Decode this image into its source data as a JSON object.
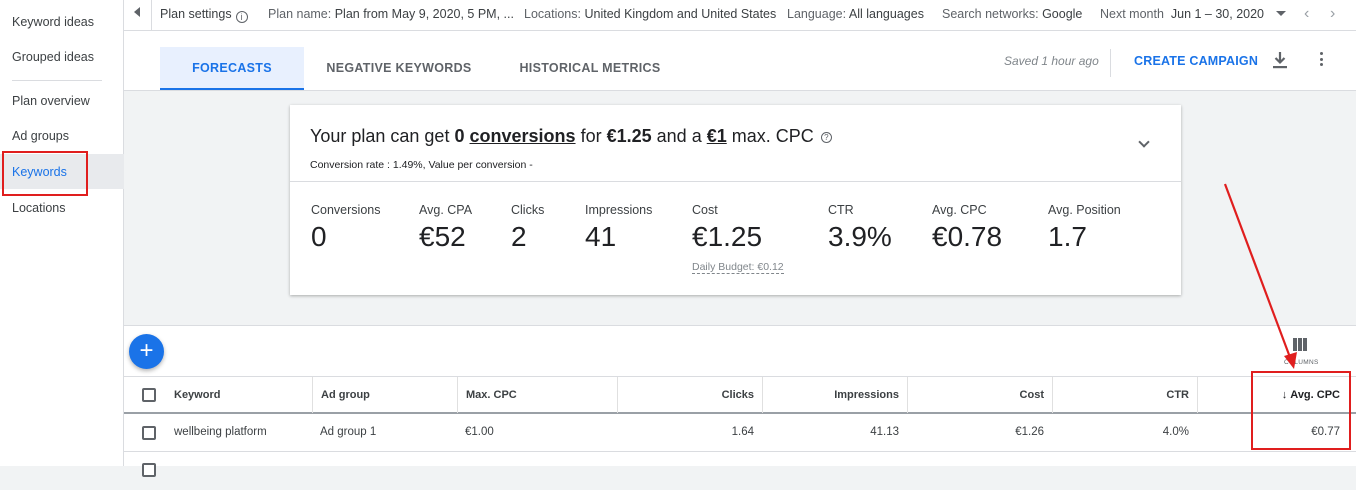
{
  "sidebar": {
    "items": [
      {
        "label": "Keyword ideas"
      },
      {
        "label": "Grouped ideas"
      },
      {
        "label": "Plan overview"
      },
      {
        "label": "Ad groups"
      },
      {
        "label": "Keywords"
      },
      {
        "label": "Locations"
      }
    ],
    "active": "Keywords"
  },
  "topbar": {
    "plan_settings": "Plan settings",
    "plan_name_label": "Plan name:",
    "plan_name": "Plan from May 9, 2020, 5 PM, ...",
    "locations_label": "Locations:",
    "locations": "United Kingdom and United States",
    "language_label": "Language:",
    "language": "All languages",
    "networks_label": "Search networks:",
    "networks": "Google",
    "period_label": "Next month",
    "period": "Jun 1 – 30, 2020"
  },
  "tabs": [
    {
      "label": "FORECASTS",
      "active": true
    },
    {
      "label": "NEGATIVE KEYWORDS",
      "active": false
    },
    {
      "label": "HISTORICAL METRICS",
      "active": false
    }
  ],
  "header": {
    "saved": "Saved 1 hour ago",
    "create_campaign": "CREATE CAMPAIGN"
  },
  "forecast": {
    "prefix": "Your plan can get",
    "conversions_count": "0",
    "conversions_word": "conversions",
    "for_word": "for",
    "cost": "€1.25",
    "and_a": "and a",
    "max_cpc": "€1",
    "max_cpc_suffix": "max. CPC",
    "subline": "Conversion rate : 1.49%, Value per conversion -",
    "metrics": [
      {
        "label": "Conversions",
        "value": "0"
      },
      {
        "label": "Avg. CPA",
        "value": "€52"
      },
      {
        "label": "Clicks",
        "value": "2"
      },
      {
        "label": "Impressions",
        "value": "41"
      },
      {
        "label": "Cost",
        "value": "€1.25"
      },
      {
        "label": "CTR",
        "value": "3.9%"
      },
      {
        "label": "Avg. CPC",
        "value": "€0.78"
      },
      {
        "label": "Avg. Position",
        "value": "1.7"
      }
    ],
    "daily_budget": "Daily Budget: €0.12"
  },
  "table": {
    "columns_label": "COLUMNS",
    "headers": [
      "Keyword",
      "Ad group",
      "Max. CPC",
      "Clicks",
      "Impressions",
      "Cost",
      "CTR",
      "Avg. CPC"
    ],
    "sort_column": "Avg. CPC",
    "rows": [
      {
        "keyword": "wellbeing platform",
        "ad_group": "Ad group 1",
        "max_cpc": "€1.00",
        "clicks": "1.64",
        "impressions": "41.13",
        "cost": "€1.26",
        "ctr": "4.0%",
        "avg_cpc": "€0.77"
      }
    ]
  },
  "colors": {
    "accent": "#1a73e8",
    "annotation": "#e01e1e"
  }
}
